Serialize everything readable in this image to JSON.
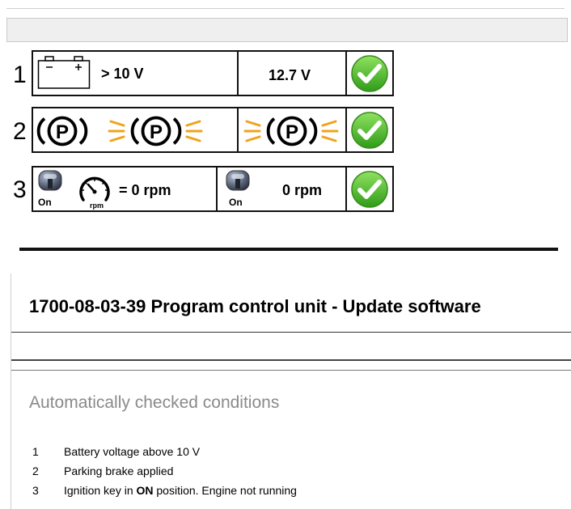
{
  "conditions": [
    {
      "number": "1",
      "requirement": "> 10 V",
      "actual": "12.7 V",
      "status": "ok",
      "icon": "battery-icon"
    },
    {
      "number": "2",
      "icon": "parking-brake-icon",
      "status": "ok"
    },
    {
      "number": "3",
      "requirement": "= 0 rpm",
      "actual": "0 rpm",
      "key_label": "On",
      "rpm_label": "rpm",
      "status": "ok",
      "icon": "ignition-key-icon"
    }
  ],
  "document": {
    "title": "1700-08-03-39 Program control unit - Update software",
    "subheading": "Automatically checked conditions",
    "items": [
      {
        "number": "1",
        "text": "Battery voltage above 10 V"
      },
      {
        "number": "2",
        "text": "Parking brake applied"
      },
      {
        "number": "3",
        "text_before": "Ignition key in ",
        "text_bold": "ON",
        "text_after": " position. Engine not running"
      }
    ]
  },
  "colors": {
    "check_green": "#4cc22a",
    "brake_warning": "#f0a21a"
  }
}
